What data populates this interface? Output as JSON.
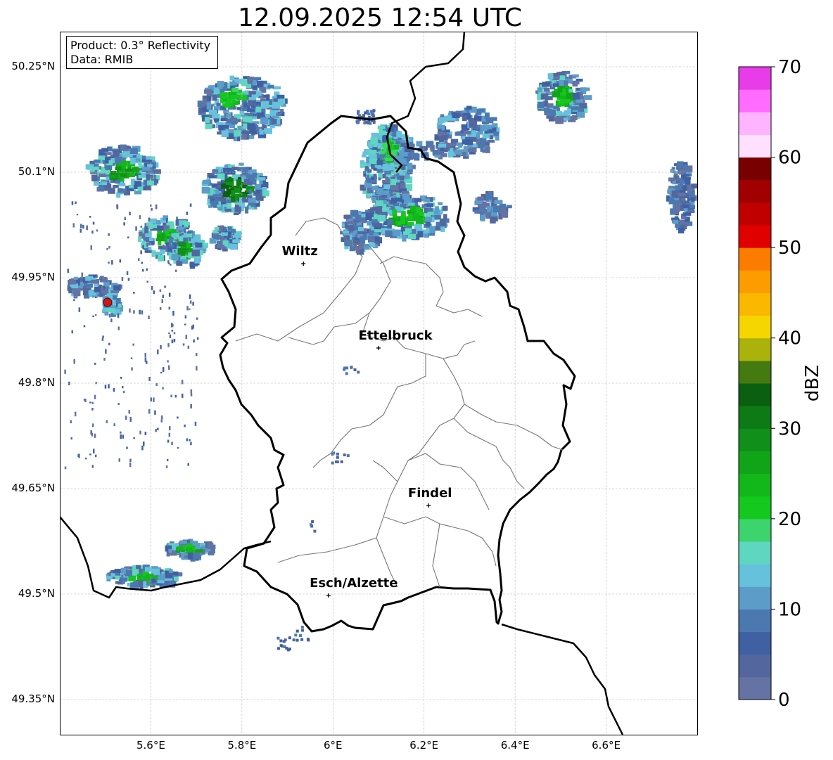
{
  "title": "12.09.2025 12:54 UTC",
  "info": {
    "product": "Product: 0.3° Reflectivity",
    "data": "Data: RMIB"
  },
  "lat_labels": [
    "50.25°N",
    "50.1°N",
    "49.95°N",
    "49.8°N",
    "49.65°N",
    "49.5°N",
    "49.35°N"
  ],
  "lon_labels": [
    "5.6°E",
    "5.8°E",
    "6°E",
    "6.2°E",
    "6.4°E",
    "6.6°E"
  ],
  "cities": [
    {
      "name": "Wiltz",
      "lon": 5.935,
      "lat": 49.97
    },
    {
      "name": "Ettelbruck",
      "lon": 6.1,
      "lat": 49.85
    },
    {
      "name": "Findel",
      "lon": 6.21,
      "lat": 49.626
    },
    {
      "name": "Esch/Alzette",
      "lon": 5.99,
      "lat": 49.498
    }
  ],
  "radar_site": {
    "lon": 5.505,
    "lat": 49.915,
    "color": "#dd1111"
  },
  "colorbar": {
    "label": "dBZ",
    "ticks": [
      "0",
      "10",
      "20",
      "30",
      "40",
      "50",
      "60",
      "70"
    ],
    "min": 0,
    "max": 70,
    "step": 2.5,
    "colors": [
      "#6473a4",
      "#53679e",
      "#4060a4",
      "#4c78b0",
      "#5c9cc8",
      "#66c2dc",
      "#5fd6c0",
      "#3cd46c",
      "#14c81e",
      "#12b81a",
      "#12a418",
      "#10901a",
      "#0d7a16",
      "#0a6010",
      "#447a10",
      "#acb20c",
      "#f5d600",
      "#fab800",
      "#fc9c00",
      "#fc7c00",
      "#e00000",
      "#c00000",
      "#a00000",
      "#780000",
      "#ffe0ff",
      "#ffb4ff",
      "#ff6cff",
      "#e83ce8"
    ]
  },
  "extent": {
    "lon_min": 5.4,
    "lon_max": 6.8,
    "lat_min": 49.3,
    "lat_max": 50.3
  }
}
